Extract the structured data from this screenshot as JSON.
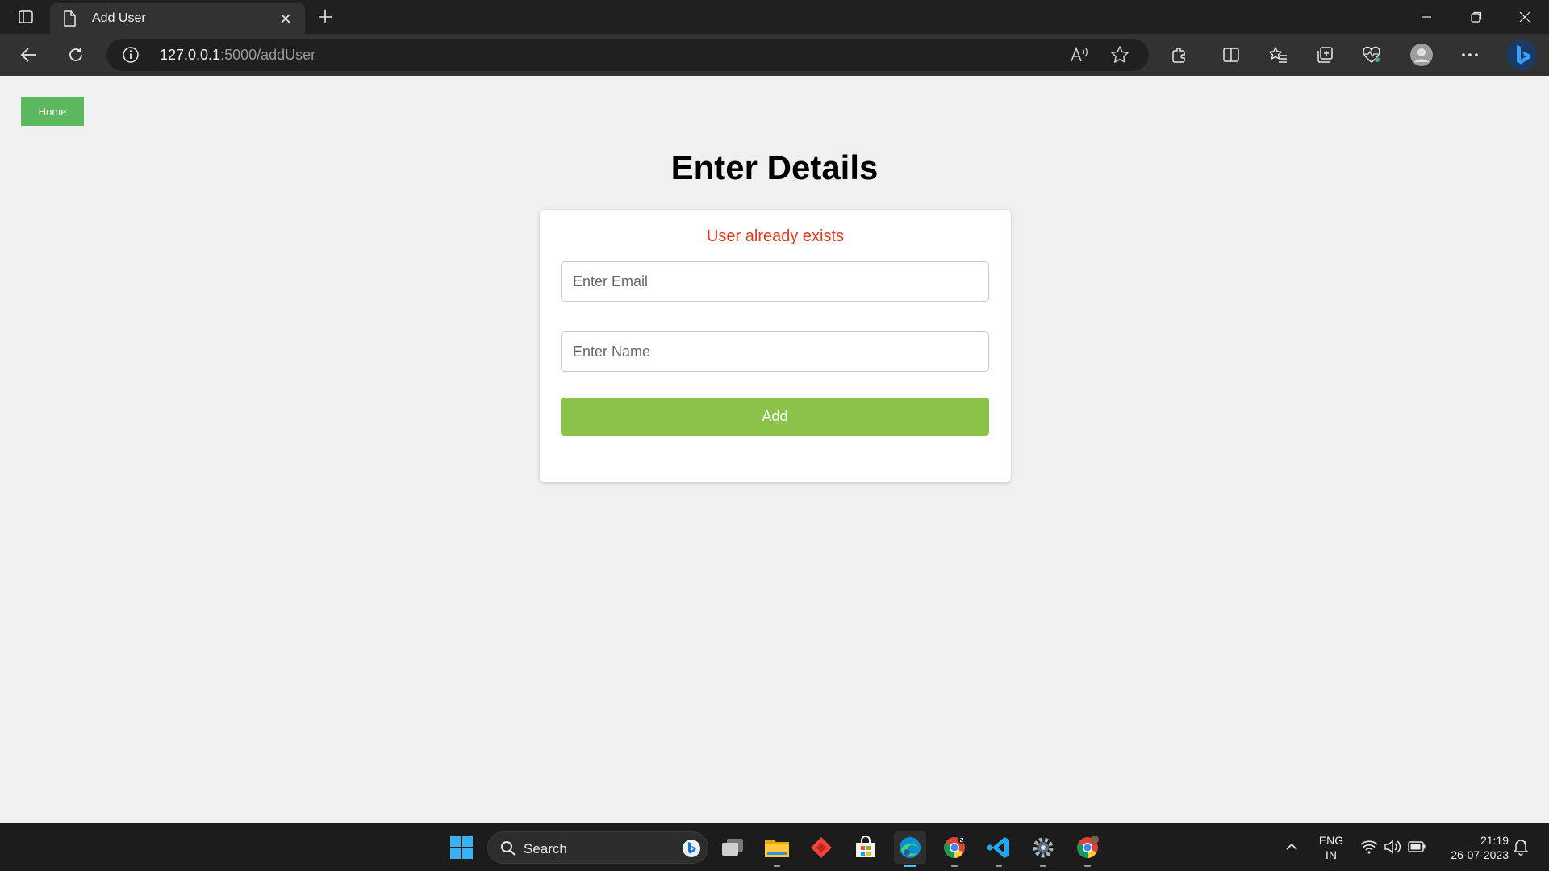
{
  "browser": {
    "tab_title": "Add User",
    "url_host": "127.0.0.1",
    "url_rest": ":5000/addUser"
  },
  "page": {
    "home_label": "Home",
    "heading": "Enter Details",
    "error_message": "User already exists",
    "email_placeholder": "Enter Email",
    "name_placeholder": "Enter Name",
    "add_label": "Add"
  },
  "taskbar": {
    "search_label": "Search",
    "lang_primary": "ENG",
    "lang_secondary": "IN",
    "time": "21:19",
    "date": "26-07-2023"
  },
  "colors": {
    "home_button": "#5cb85c",
    "add_button": "#8bc34a",
    "error_text": "#e03a1e"
  }
}
